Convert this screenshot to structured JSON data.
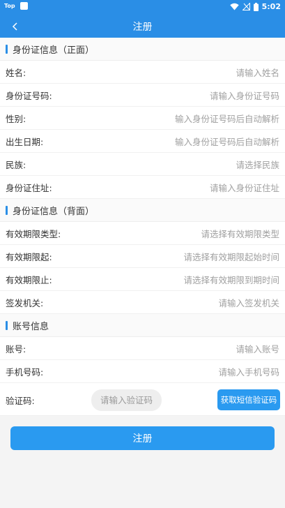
{
  "status_bar": {
    "app_tag": "Top",
    "time": "5:02"
  },
  "nav": {
    "title": "注册"
  },
  "sections": [
    {
      "title": "身份证信息（正面）",
      "rows": [
        {
          "label": "姓名:",
          "placeholder": "请输入姓名"
        },
        {
          "label": "身份证号码:",
          "placeholder": "请输入身份证号码"
        },
        {
          "label": "性别:",
          "placeholder": "输入身份证号码后自动解析"
        },
        {
          "label": "出生日期:",
          "placeholder": "输入身份证号码后自动解析"
        },
        {
          "label": "民族:",
          "placeholder": "请选择民族"
        },
        {
          "label": "身份证住址:",
          "placeholder": "请输入身份证住址"
        }
      ]
    },
    {
      "title": "身份证信息（背面）",
      "rows": [
        {
          "label": "有效期限类型:",
          "placeholder": "请选择有效期限类型"
        },
        {
          "label": "有效期限起:",
          "placeholder": "请选择有效期限起始时间"
        },
        {
          "label": "有效期限止:",
          "placeholder": "请选择有效期限到期时间"
        },
        {
          "label": "签发机关:",
          "placeholder": "请输入签发机关"
        }
      ]
    },
    {
      "title": "账号信息",
      "rows": [
        {
          "label": "账号:",
          "placeholder": "请输入账号"
        },
        {
          "label": "手机号码:",
          "placeholder": "请输入手机号码"
        }
      ]
    }
  ],
  "verification": {
    "label": "验证码:",
    "placeholder": "请输入验证码",
    "sms_button": "获取短信验证码"
  },
  "submit_button": "注册",
  "colors": {
    "primary": "#2a8ee6",
    "button": "#2a9af0",
    "background": "#f4f4f4"
  }
}
